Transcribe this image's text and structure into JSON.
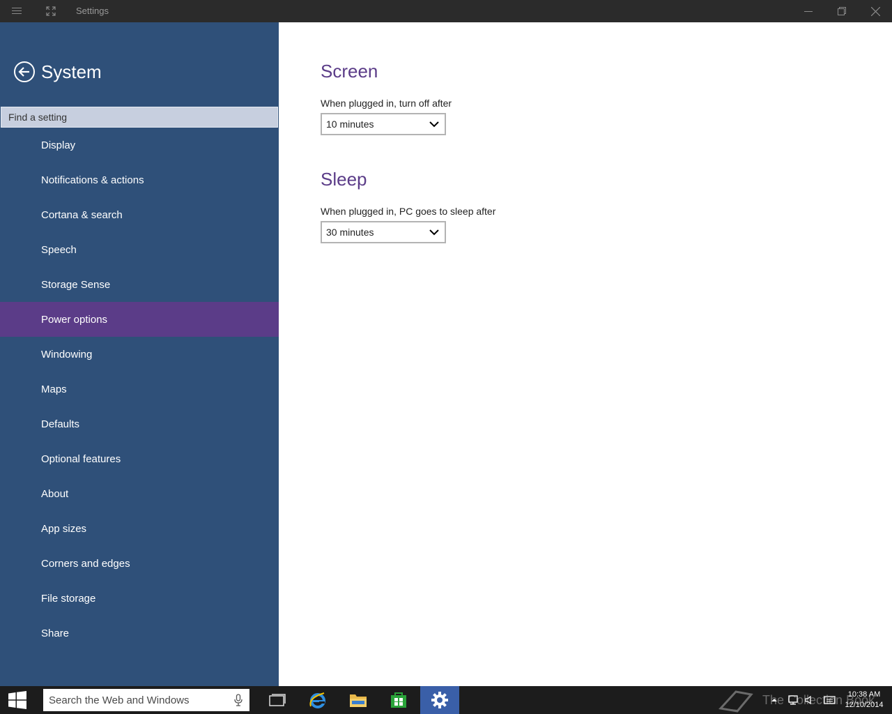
{
  "titlebar": {
    "title": "Settings",
    "icons": [
      "hamburger-icon",
      "fullscreen-icon",
      "minimize-icon",
      "restore-icon",
      "close-icon"
    ]
  },
  "sidebar": {
    "title": "System",
    "search_placeholder": "Find a setting",
    "items": [
      {
        "label": "Display"
      },
      {
        "label": "Notifications & actions"
      },
      {
        "label": "Cortana & search"
      },
      {
        "label": "Speech"
      },
      {
        "label": "Storage Sense"
      },
      {
        "label": "Power options",
        "selected": true
      },
      {
        "label": "Windowing"
      },
      {
        "label": "Maps"
      },
      {
        "label": "Defaults"
      },
      {
        "label": "Optional features"
      },
      {
        "label": "About"
      },
      {
        "label": "App sizes"
      },
      {
        "label": "Corners and edges"
      },
      {
        "label": "File storage"
      },
      {
        "label": "Share"
      }
    ]
  },
  "content": {
    "screen": {
      "title": "Screen",
      "label": "When plugged in, turn off after",
      "value": "10 minutes"
    },
    "sleep": {
      "title": "Sleep",
      "label": "When plugged in, PC goes to sleep after",
      "value": "30 minutes"
    }
  },
  "taskbar": {
    "search_placeholder": "Search the Web and Windows",
    "apps": [
      "task-view-icon",
      "internet-explorer-icon",
      "file-explorer-icon",
      "store-icon",
      "settings-icon"
    ],
    "active_app": "settings-icon",
    "watermark": "The Collection Book",
    "time": "10:38 AM",
    "date": "12/10/2014"
  },
  "colors": {
    "sidebar_bg": "#2f5079",
    "selected_bg": "#5b3c88",
    "accent": "#5b3c88",
    "titlebar_bg": "#2b2b2b",
    "taskbar_bg": "#1c1c1c"
  }
}
